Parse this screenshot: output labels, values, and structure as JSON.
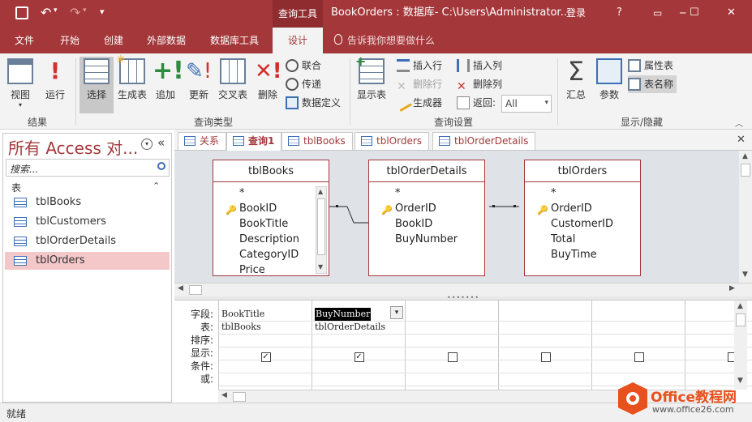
{
  "titlebar": {
    "context_tab": "查询工具",
    "title": "BookOrders : 数据库- C:\\Users\\Administrator...",
    "login": "登录",
    "help": "?",
    "minimize": "─",
    "maximize": "☐",
    "close": "✕"
  },
  "tabs": {
    "file": "文件",
    "home": "开始",
    "create": "创建",
    "external": "外部数据",
    "dbtools": "数据库工具",
    "design": "设计",
    "tellme": "告诉我你想要做什么"
  },
  "ribbon": {
    "view": "视图",
    "run": "运行",
    "group_results": "结果",
    "select": "选择",
    "make_table": "生成表",
    "append": "追加",
    "update": "更新",
    "crosstab": "交叉表",
    "delete": "删除",
    "union": "联合",
    "passthrough": "传递",
    "data_definition": "数据定义",
    "group_query_type": "查询类型",
    "show_table": "显示表",
    "insert_rows": "插入行",
    "delete_rows": "删除行",
    "builder": "生成器",
    "insert_cols": "插入列",
    "delete_cols": "删除列",
    "return_label": "返回:",
    "return_value": "All",
    "group_query_setup": "查询设置",
    "totals": "汇总",
    "parameters": "参数",
    "property_sheet": "属性表",
    "table_names": "表名称",
    "group_show_hide": "显示/隐藏"
  },
  "nav": {
    "title": "所有 Access 对...",
    "search_placeholder": "搜索...",
    "section": "表",
    "items": [
      "tblBooks",
      "tblCustomers",
      "tblOrderDetails",
      "tblOrders"
    ]
  },
  "doc_tabs": [
    "关系",
    "查询1",
    "tblBooks",
    "tblOrders",
    "tblOrderDetails"
  ],
  "tables": [
    {
      "name": "tblBooks",
      "fields": [
        "*",
        "BookID",
        "BookTitle",
        "Description",
        "CategoryID",
        "Price"
      ],
      "key_index": 1
    },
    {
      "name": "tblOrderDetails",
      "fields": [
        "*",
        "OrderID",
        "BookID",
        "BuyNumber"
      ],
      "key_index": 1
    },
    {
      "name": "tblOrders",
      "fields": [
        "*",
        "OrderID",
        "CustomerID",
        "Total",
        "BuyTime"
      ],
      "key_index": 1
    }
  ],
  "grid": {
    "row_labels": [
      "字段:",
      "表:",
      "排序:",
      "显示:",
      "条件:",
      "或:"
    ],
    "columns": [
      {
        "field": "BookTitle",
        "table": "tblBooks",
        "show": true
      },
      {
        "field": "BuyNumber",
        "table": "tblOrderDetails",
        "show": true
      },
      {
        "field": "",
        "table": "",
        "show": false
      },
      {
        "field": "",
        "table": "",
        "show": false
      },
      {
        "field": "",
        "table": "",
        "show": false
      },
      {
        "field": "",
        "table": "",
        "show": false
      }
    ]
  },
  "status": {
    "text": "就绪"
  },
  "watermark": {
    "brand": "Office教程网",
    "url": "www.office26.com"
  },
  "colors": {
    "accent": "#a4373a",
    "nav_selected": "#f4c7c9",
    "design_bg": "#dfe3e8"
  }
}
